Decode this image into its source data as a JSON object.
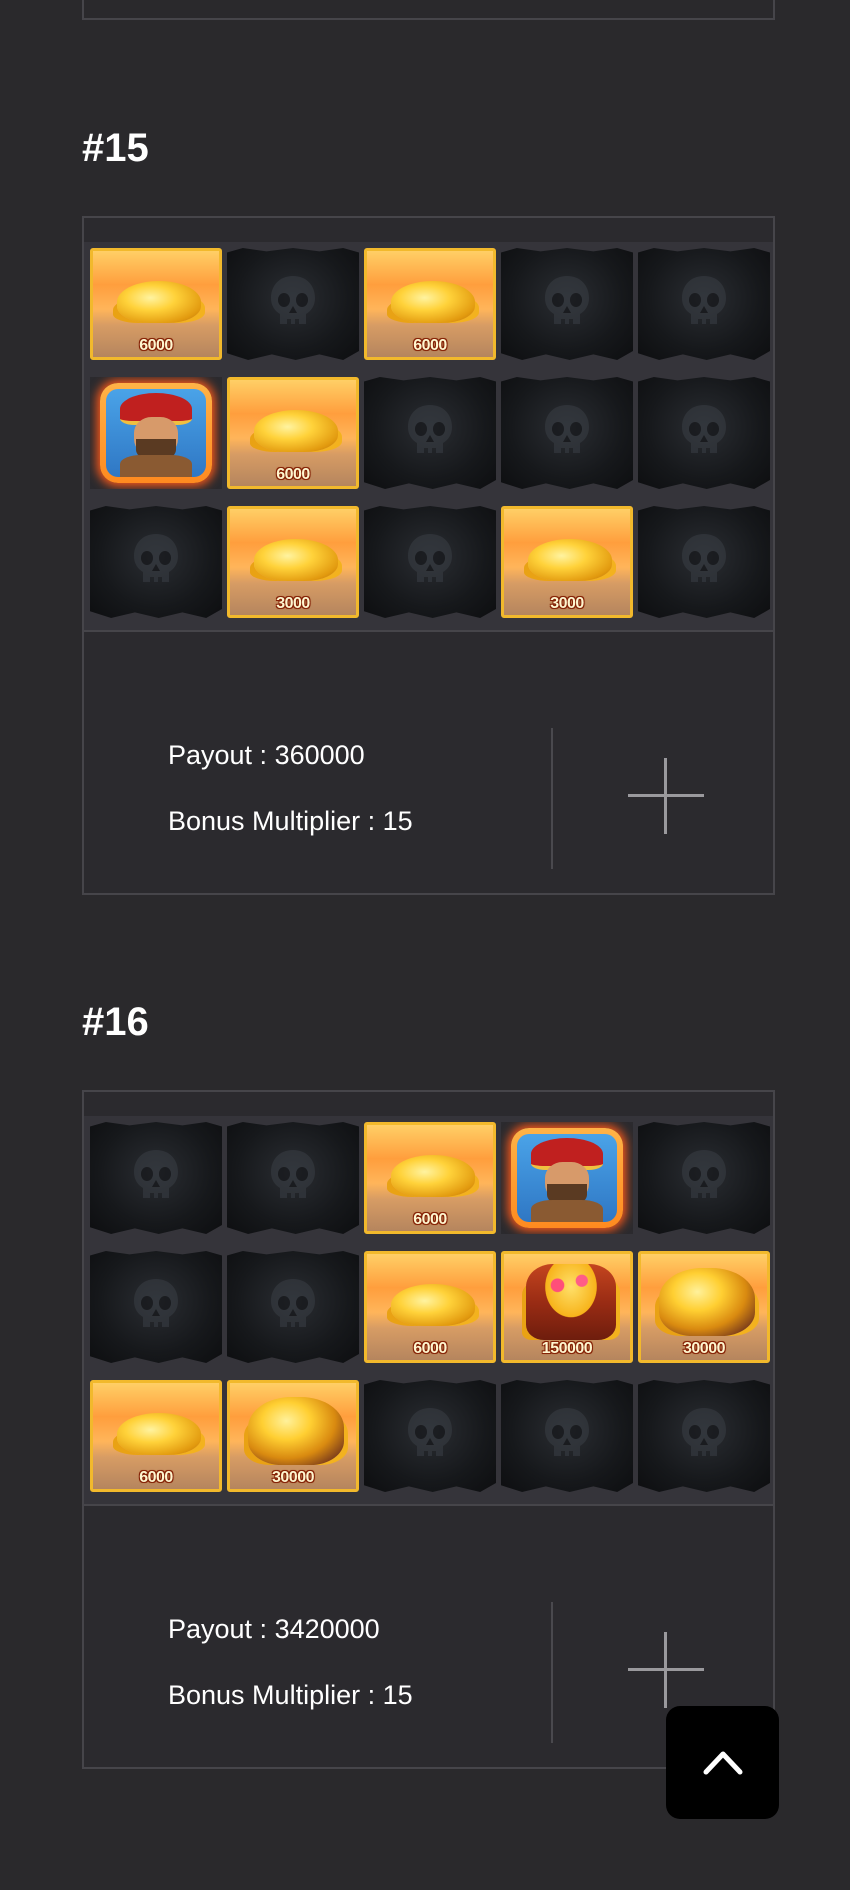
{
  "sections": [
    {
      "title": "#15",
      "grid": [
        [
          {
            "type": "gold",
            "value": "6000"
          },
          {
            "type": "flag"
          },
          {
            "type": "gold",
            "value": "6000"
          },
          {
            "type": "flag"
          },
          {
            "type": "flag"
          }
        ],
        [
          {
            "type": "pirate"
          },
          {
            "type": "gold",
            "value": "6000"
          },
          {
            "type": "flag"
          },
          {
            "type": "flag"
          },
          {
            "type": "flag"
          }
        ],
        [
          {
            "type": "flag"
          },
          {
            "type": "gold",
            "value": "3000"
          },
          {
            "type": "flag"
          },
          {
            "type": "gold",
            "value": "3000"
          },
          {
            "type": "flag"
          }
        ]
      ],
      "payout": "Payout : 360000",
      "bonus": "Bonus Multiplier : 15"
    },
    {
      "title": "#16",
      "grid": [
        [
          {
            "type": "flag"
          },
          {
            "type": "flag"
          },
          {
            "type": "gold",
            "value": "6000"
          },
          {
            "type": "pirate"
          },
          {
            "type": "flag"
          }
        ],
        [
          {
            "type": "flag"
          },
          {
            "type": "flag"
          },
          {
            "type": "gold",
            "value": "6000"
          },
          {
            "type": "barrel",
            "value": "150000"
          },
          {
            "type": "chest",
            "value": "30000"
          }
        ],
        [
          {
            "type": "gold",
            "value": "6000"
          },
          {
            "type": "chest",
            "value": "30000"
          },
          {
            "type": "flag"
          },
          {
            "type": "flag"
          },
          {
            "type": "flag"
          }
        ]
      ],
      "payout": "Payout : 3420000",
      "bonus": "Bonus Multiplier : 15"
    }
  ],
  "icons": {
    "expand": "plus-icon",
    "scroll_top": "chevron-up-icon",
    "symbol_flag": "skull-flag-icon",
    "symbol_pirate": "pirate-captain-icon"
  }
}
